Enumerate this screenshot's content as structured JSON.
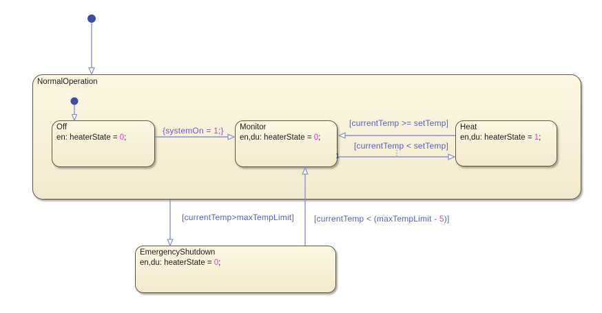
{
  "diagram": {
    "type": "stateflow-state-machine",
    "colors": {
      "state_fill_top": "#FDF7E3",
      "state_fill_bottom": "#F2E9CD",
      "state_border": "#595548",
      "transition_line": "#8A93C8",
      "default_dot": "#3E4C9E",
      "condition_label": "#5560BF",
      "action_label": "#6F54C8",
      "number_literal": "#DA3BD3",
      "state_text": "#1A1A1A"
    },
    "states": {
      "normal_operation": {
        "name": "NormalOperation"
      },
      "off": {
        "name": "Off",
        "action_prefix": "en: heaterState = ",
        "action_value": "0",
        "action_suffix": ";"
      },
      "monitor": {
        "name": "Monitor",
        "action_prefix": "en,du: heaterState = ",
        "action_value": "0",
        "action_suffix": ";"
      },
      "heat": {
        "name": "Heat",
        "action_prefix": "en,du: heaterState = ",
        "action_value": "1",
        "action_suffix": ";"
      },
      "emergency_shutdown": {
        "name": "EmergencyShutdown",
        "action_prefix": "en,du: heaterState = ",
        "action_value": "0",
        "action_suffix": ";"
      }
    },
    "transitions": {
      "off_to_monitor": {
        "label_prefix": "{systemOn = ",
        "label_value": "1",
        "label_suffix": ";}"
      },
      "heat_to_monitor": {
        "label": "[currentTemp >= setTemp]"
      },
      "monitor_to_heat": {
        "label": "[currentTemp < setTemp]",
        "priority": "1"
      },
      "normal_to_emergency": {
        "label": "[currentTemp>maxTempLimit]"
      },
      "emergency_to_monitor": {
        "label_prefix": "[currentTemp < (maxTempLimit - ",
        "label_value": "5",
        "label_suffix": ")]"
      }
    }
  }
}
